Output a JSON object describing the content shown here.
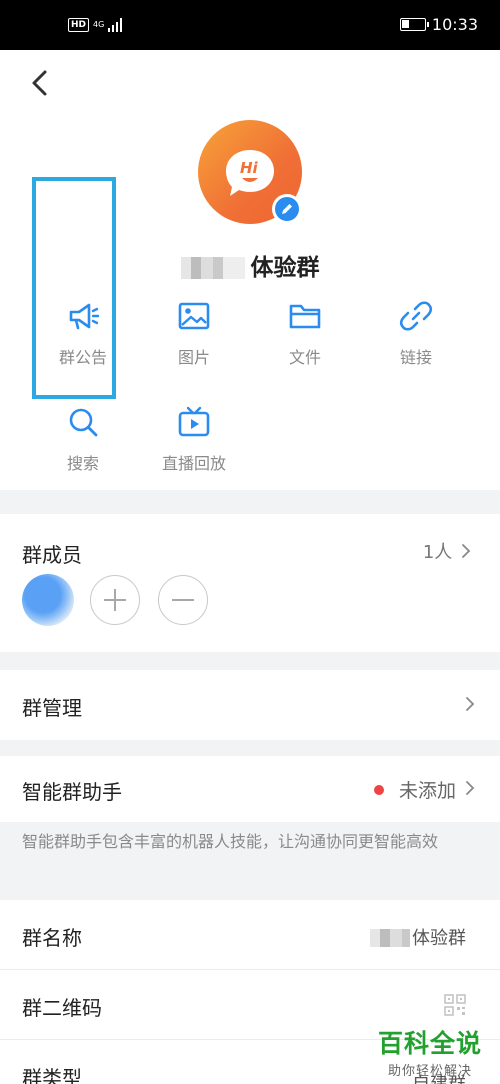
{
  "status_bar": {
    "hd": "HD",
    "network": "4G",
    "time": "10:33"
  },
  "group": {
    "name": "体验群",
    "avatar_text": "Hi"
  },
  "functions": [
    {
      "label": "群公告",
      "icon": "megaphone-icon"
    },
    {
      "label": "图片",
      "icon": "image-icon"
    },
    {
      "label": "文件",
      "icon": "folder-icon"
    },
    {
      "label": "链接",
      "icon": "link-icon"
    },
    {
      "label": "搜索",
      "icon": "search-icon"
    },
    {
      "label": "直播回放",
      "icon": "tv-icon"
    }
  ],
  "members": {
    "title": "群成员",
    "count": "1人"
  },
  "manage": {
    "title": "群管理"
  },
  "assistant": {
    "title": "智能群助手",
    "status": "未添加",
    "description": "智能群助手包含丰富的机器人技能，让沟通协同更智能高效"
  },
  "info": {
    "name_label": "群名称",
    "name_value": "体验群",
    "qrcode_label": "群二维码",
    "type_label": "群类型",
    "type_value": "自建群"
  },
  "watermark": {
    "main": "百科全说",
    "sub": "助你轻松解决"
  },
  "colors": {
    "accent": "#2b8cf0",
    "highlight": "#2ba9e0",
    "avatar": "#f07036",
    "dot": "#f04343",
    "watermark": "#23a12f"
  }
}
